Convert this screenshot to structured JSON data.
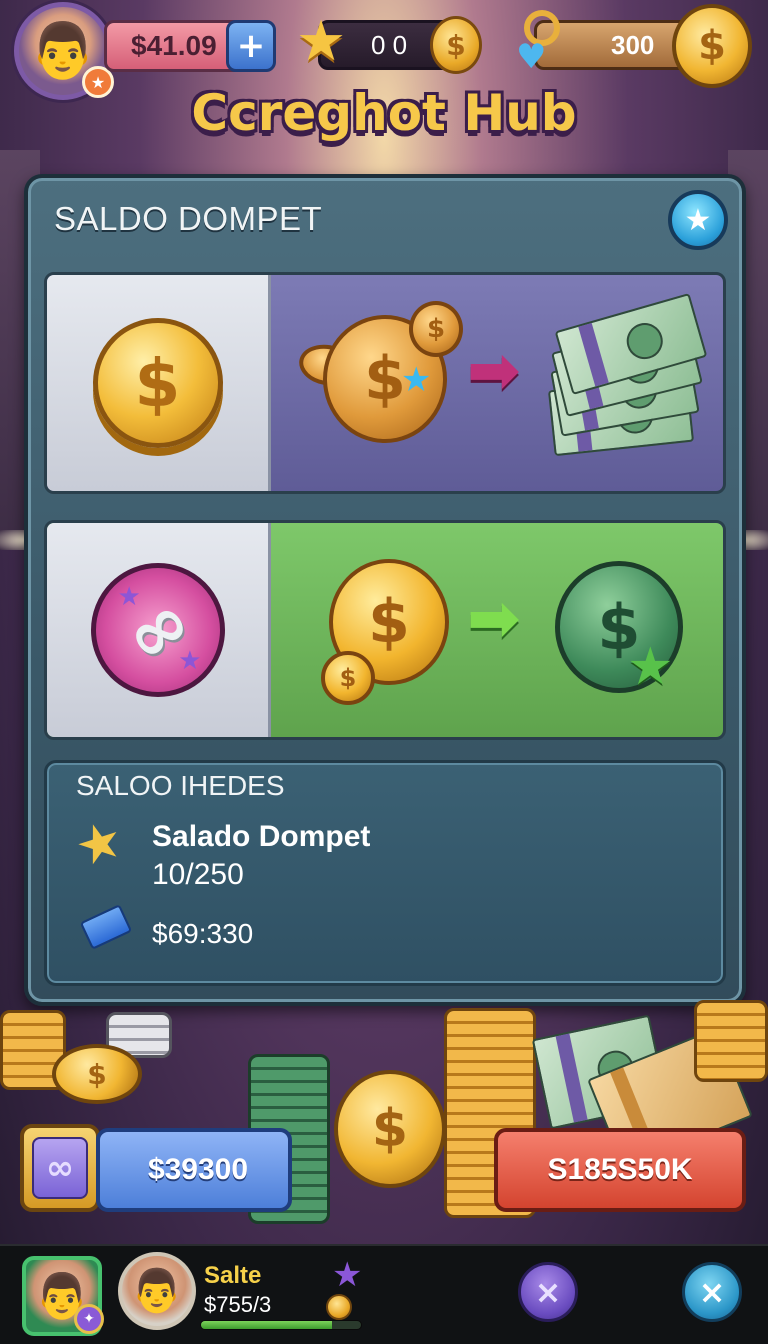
{
  "hud": {
    "money": "$41.09",
    "plus_label": "+",
    "stars_value": "0 0",
    "coins_value": "300",
    "coin_symbol": "$"
  },
  "title": "Ccreghot Hub",
  "panel": {
    "title": "SALDO DOMPET",
    "favorite_icon": "★",
    "row1": {
      "left_icon": "gold-coin",
      "from_icon": "gold-coin-with-star",
      "to_icon": "cash-stack",
      "arrow_color": "#c0317a"
    },
    "row2": {
      "left_icon": "pretzel-badge",
      "from_icon": "gold-coins",
      "to_icon": "green-coin-with-star",
      "arrow_color": "#7fdd4f"
    }
  },
  "info": {
    "title": "SALOO IHEDES",
    "name": "Salado Dompet",
    "progress": "10/250",
    "amount": "$69:330"
  },
  "buttons": {
    "left_label": "$39300",
    "right_label": "S185S50K"
  },
  "bottom": {
    "player_name": "Salte",
    "player_value": "$755/3",
    "progress_fraction": 0.82,
    "purple_button": "×",
    "close_button": "×"
  },
  "colors": {
    "title_gold": "#f6c84a",
    "panel": "#3a5868",
    "row1_bg": "#6d6aa8",
    "row2_bg": "#6fb65b",
    "right_button": "#e0503a",
    "left_button": "#5c8ce2"
  }
}
